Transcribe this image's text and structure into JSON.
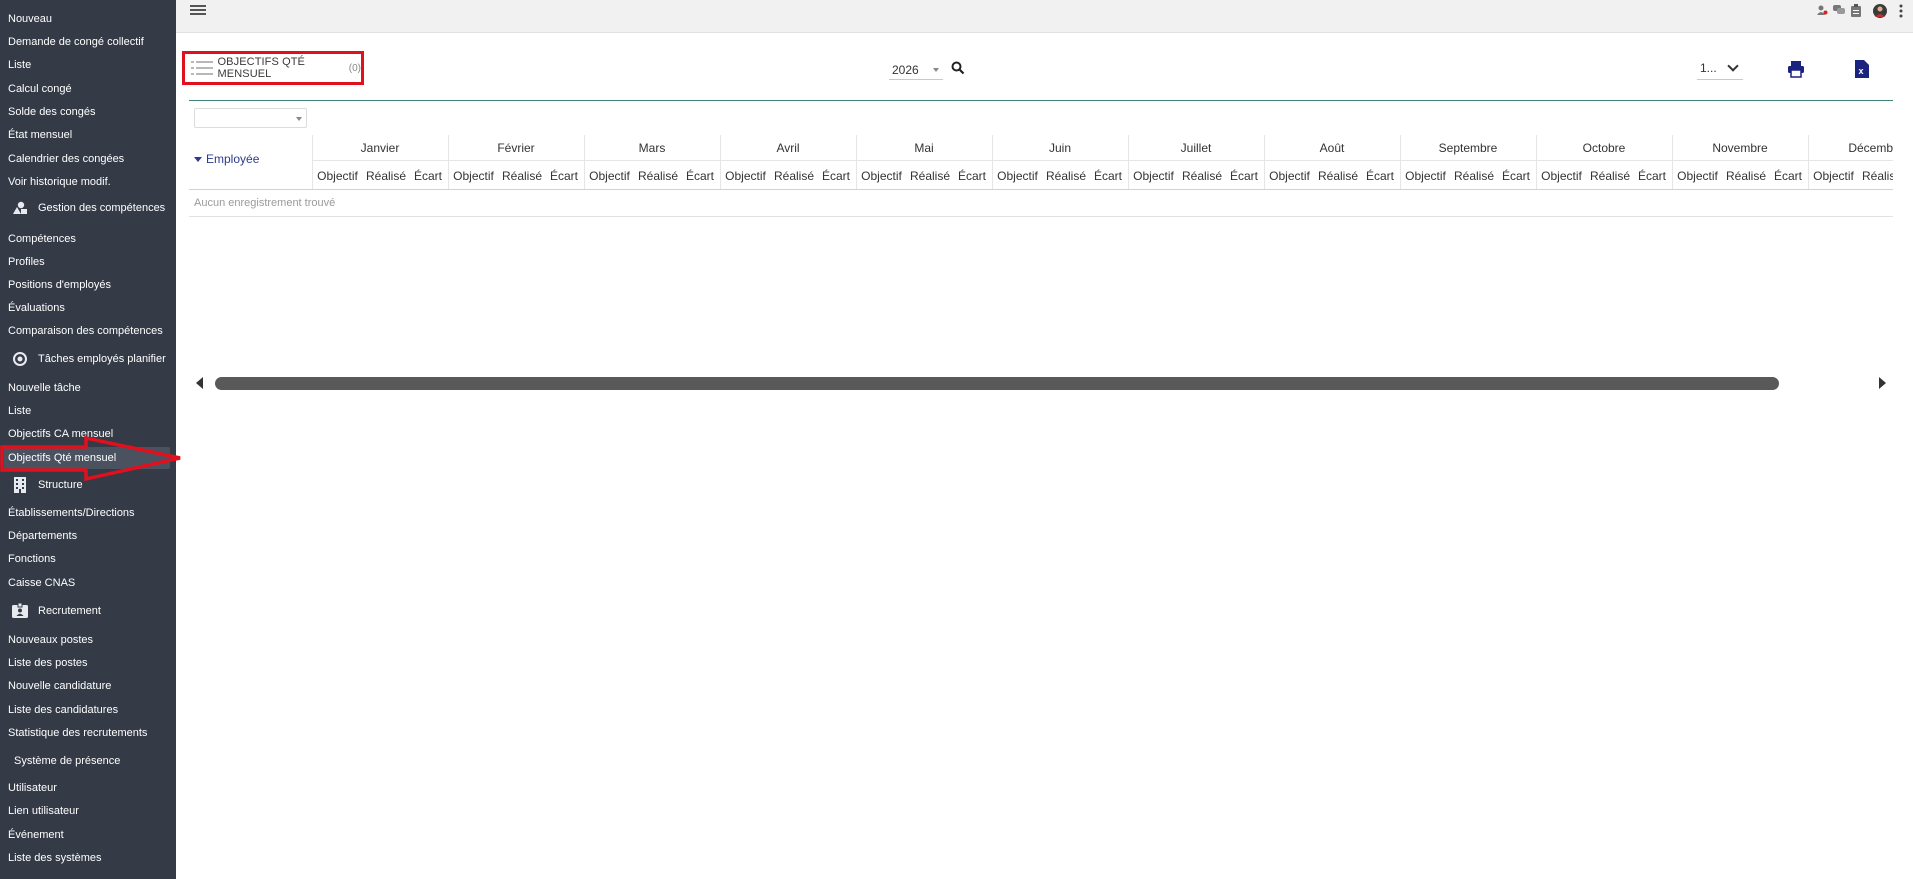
{
  "sidebar": {
    "items": [
      {
        "label": "Nouveau",
        "type": "item"
      },
      {
        "label": "Demande de congé collectif",
        "type": "item"
      },
      {
        "label": "Liste",
        "type": "item"
      },
      {
        "label": "Calcul congé",
        "type": "item"
      },
      {
        "label": "Solde des congés",
        "type": "item"
      },
      {
        "label": "État mensuel",
        "type": "item"
      },
      {
        "label": "Calendrier des congées",
        "type": "item"
      },
      {
        "label": "Voir historique modif.",
        "type": "item"
      },
      {
        "label": "Gestion des compétences",
        "type": "section",
        "icon": "shapes-icon"
      },
      {
        "label": "Compétences",
        "type": "item"
      },
      {
        "label": "Profiles",
        "type": "item"
      },
      {
        "label": "Positions d'employés",
        "type": "item"
      },
      {
        "label": "Évaluations",
        "type": "item"
      },
      {
        "label": "Comparaison des compétences",
        "type": "item"
      },
      {
        "label": "Tâches employés planifier",
        "type": "section",
        "icon": "target-icon"
      },
      {
        "label": "Nouvelle tâche",
        "type": "item"
      },
      {
        "label": "Liste",
        "type": "item"
      },
      {
        "label": "Objectifs CA mensuel",
        "type": "item"
      },
      {
        "label": "Objectifs Qté mensuel",
        "type": "item",
        "active": true
      },
      {
        "label": "Structure",
        "type": "section",
        "icon": "building-icon"
      },
      {
        "label": "Établissements/Directions",
        "type": "item"
      },
      {
        "label": "Départements",
        "type": "item"
      },
      {
        "label": "Fonctions",
        "type": "item"
      },
      {
        "label": "Caisse CNAS",
        "type": "item"
      },
      {
        "label": "Recrutement",
        "type": "section",
        "icon": "id-badge-icon"
      },
      {
        "label": "Nouveaux postes",
        "type": "item"
      },
      {
        "label": "Liste des postes",
        "type": "item"
      },
      {
        "label": "Nouvelle candidature",
        "type": "item"
      },
      {
        "label": "Liste des candidatures",
        "type": "item"
      },
      {
        "label": "Statistique des recrutements",
        "type": "item"
      },
      {
        "label": "Système de présence",
        "type": "section",
        "icon": ""
      },
      {
        "label": "Utilisateur",
        "type": "item"
      },
      {
        "label": "Lien utilisateur",
        "type": "item"
      },
      {
        "label": "Événement",
        "type": "item"
      },
      {
        "label": "Liste des systèmes",
        "type": "item"
      }
    ]
  },
  "topbar": {
    "icons": [
      "user-alert-icon",
      "chat-icon",
      "clipboard-icon",
      "avatar-icon",
      "more-vertical-icon"
    ]
  },
  "header": {
    "title": "OBJECTIFS QTÉ MENSUEL",
    "count": "(0)",
    "year": "2026",
    "page_size": "1..."
  },
  "table": {
    "employee_label": "Employée",
    "months": [
      "Janvier",
      "Février",
      "Mars",
      "Avril",
      "Mai",
      "Juin",
      "Juillet",
      "Août",
      "Septembre",
      "Octobre",
      "Novembre",
      "Décembre"
    ],
    "subcolumns": [
      "Objectif",
      "Réalisé",
      "Écart"
    ],
    "empty_message": "Aucun enregistrement trouvé"
  },
  "colors": {
    "sidebar_bg": "#343a46",
    "annotation_red": "#e0101e",
    "accent_teal": "#40857a",
    "link_blue": "#2b3a8f"
  }
}
